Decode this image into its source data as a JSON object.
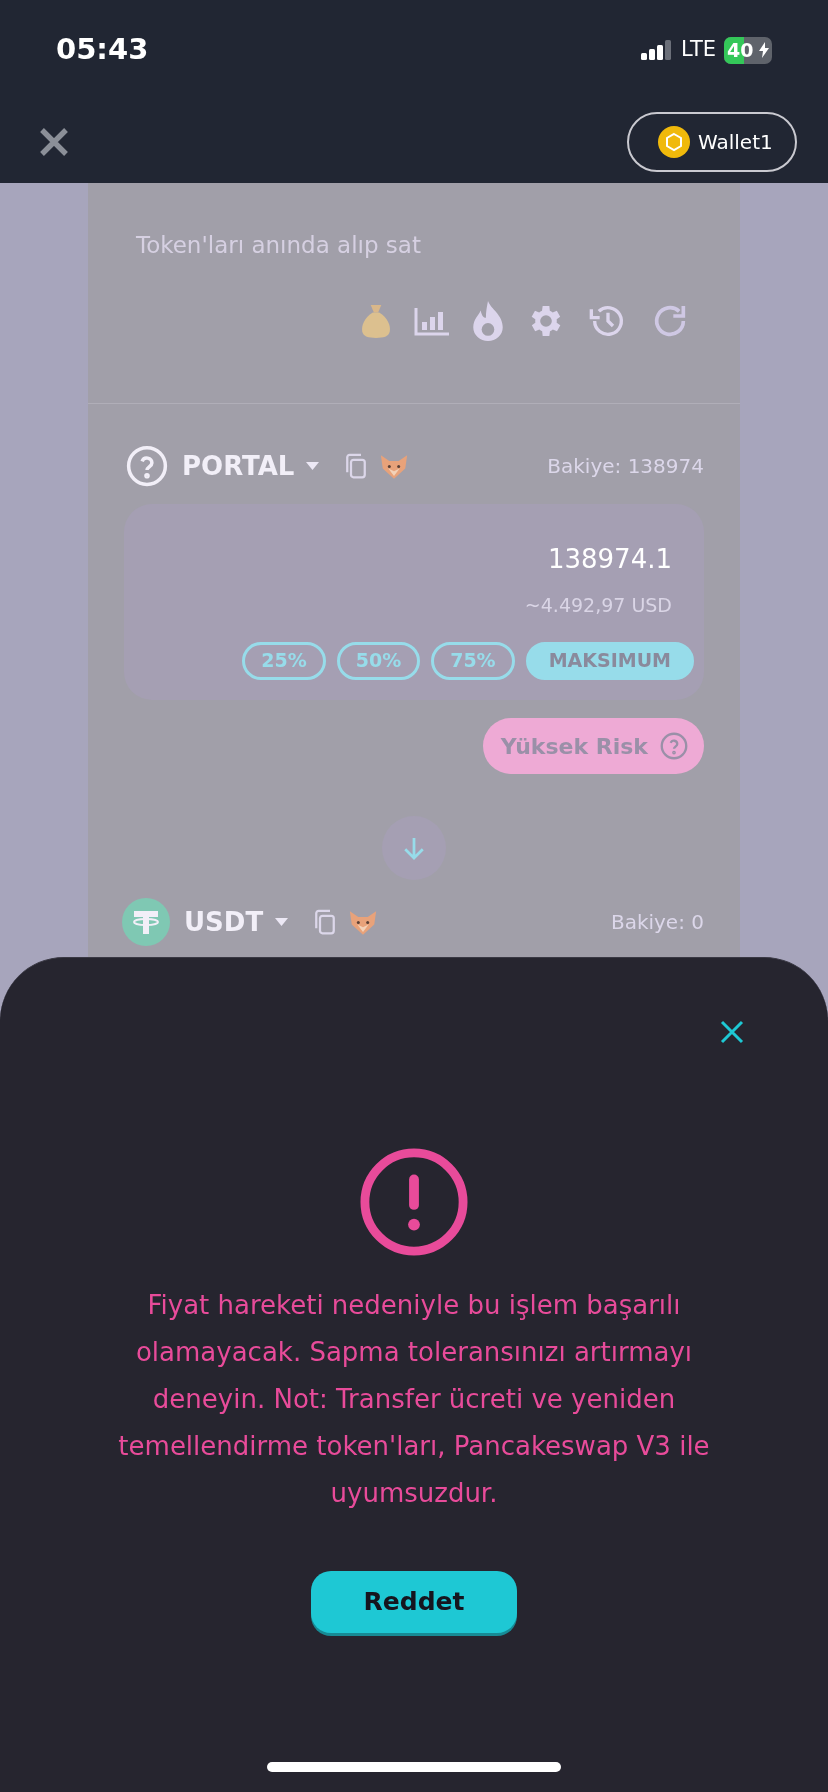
{
  "status_bar": {
    "time": "05:43",
    "network": "LTE",
    "battery": "40"
  },
  "header": {
    "wallet": "Wallet1"
  },
  "swap": {
    "subtitle": "Token'ları anında alıp sat",
    "from": {
      "symbol": "PORTAL",
      "balance": "Bakiye: 138974",
      "amount": "138974.1",
      "usd": "~4.492,97 USD",
      "percent_buttons": [
        {
          "label": "25%",
          "selected": false
        },
        {
          "label": "50%",
          "selected": false
        },
        {
          "label": "75%",
          "selected": false
        },
        {
          "label": "MAKSIMUM",
          "selected": true
        }
      ]
    },
    "risk": "Yüksek Risk",
    "to": {
      "symbol": "USDT",
      "balance": "Bakiye: 0"
    }
  },
  "error_sheet": {
    "message": "Fiyat hareketi nedeniyle bu işlem başarılı olamayacak. Sapma toleransınızı artırmayı deneyin. Not: Transfer ücreti ve yeniden temellendirme token'ları, Pancakeswap V3 ile uyumsuzdur.",
    "button": "Reddet"
  }
}
